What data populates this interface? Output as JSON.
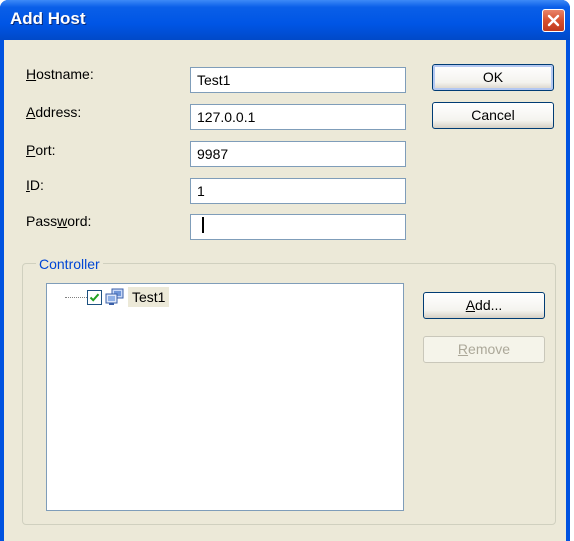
{
  "window": {
    "title": "Add Host"
  },
  "form": {
    "hostname": {
      "label_u": "H",
      "label_rest": "ostname:",
      "value": "Test1"
    },
    "address": {
      "label_u": "A",
      "label_rest": "ddress:",
      "value": "127.0.0.1"
    },
    "port": {
      "label_u": "P",
      "label_rest": "ort:",
      "value": "9987"
    },
    "id": {
      "label_u": "I",
      "label_rest": "D:",
      "value": "1"
    },
    "password": {
      "label_pre": "Pass",
      "label_u": "w",
      "label_rest": "ord:",
      "value": ""
    }
  },
  "buttons": {
    "ok": "OK",
    "cancel": "Cancel",
    "add_u": "A",
    "add_rest": "dd...",
    "remove_u": "R",
    "remove_rest": "emove"
  },
  "controller": {
    "group_label": "Controller",
    "items": [
      {
        "label": "Test1",
        "checked": true
      }
    ]
  },
  "colors": {
    "titlebar": "#0055e5",
    "dialog_bg": "#ece9d8",
    "group_label": "#0046d5",
    "close_button": "#d6502f"
  },
  "icons": [
    "close-icon",
    "checkbox-checked-icon",
    "computers-icon"
  ]
}
